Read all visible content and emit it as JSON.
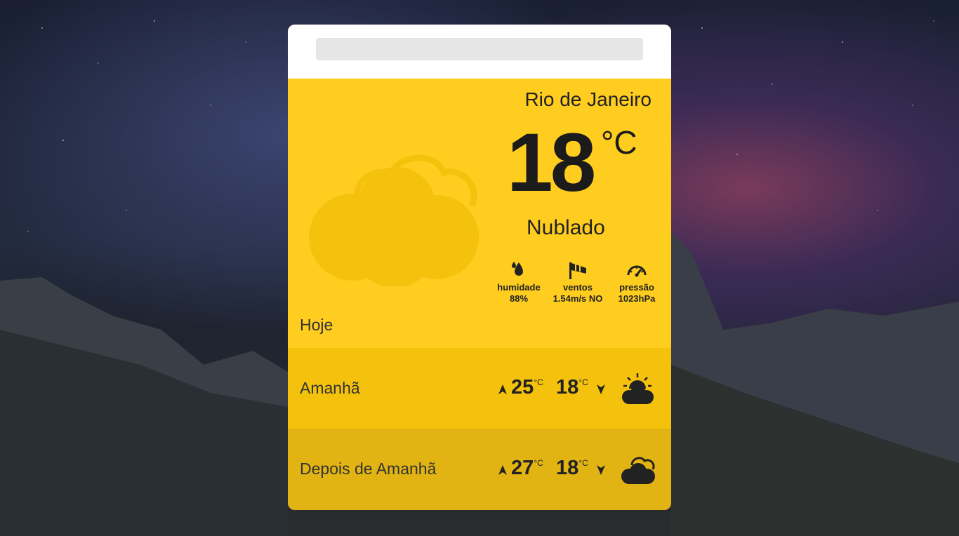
{
  "search": {
    "placeholder": ""
  },
  "today": {
    "city": "Rio de Janeiro",
    "temperature": "18",
    "unit": "°C",
    "condition": "Nublado",
    "label": "Hoje",
    "icon": "cloud-icon",
    "stats": [
      {
        "icon": "humidity-drops-icon",
        "label": "humidade",
        "value": "88%"
      },
      {
        "icon": "windsock-icon",
        "label": "ventos",
        "value": "1.54m/s NO"
      },
      {
        "icon": "pressure-gauge-icon",
        "label": "pressão",
        "value": "1023hPa"
      }
    ]
  },
  "forecast": [
    {
      "day": "Amanhã",
      "high": "25",
      "low": "18",
      "unit": "°C",
      "icon": "sun-behind-cloud-icon"
    },
    {
      "day": "Depois de Amanhã",
      "high": "27",
      "low": "18",
      "unit": "°C",
      "icon": "clouds-icon"
    }
  ],
  "colors": {
    "card_yellow": "#ffcd1f",
    "row1_yellow": "#f4c20d",
    "row2_yellow": "#e2b413",
    "cloud_fill": "#f4c20d",
    "text_dark": "#1b1b1b"
  }
}
